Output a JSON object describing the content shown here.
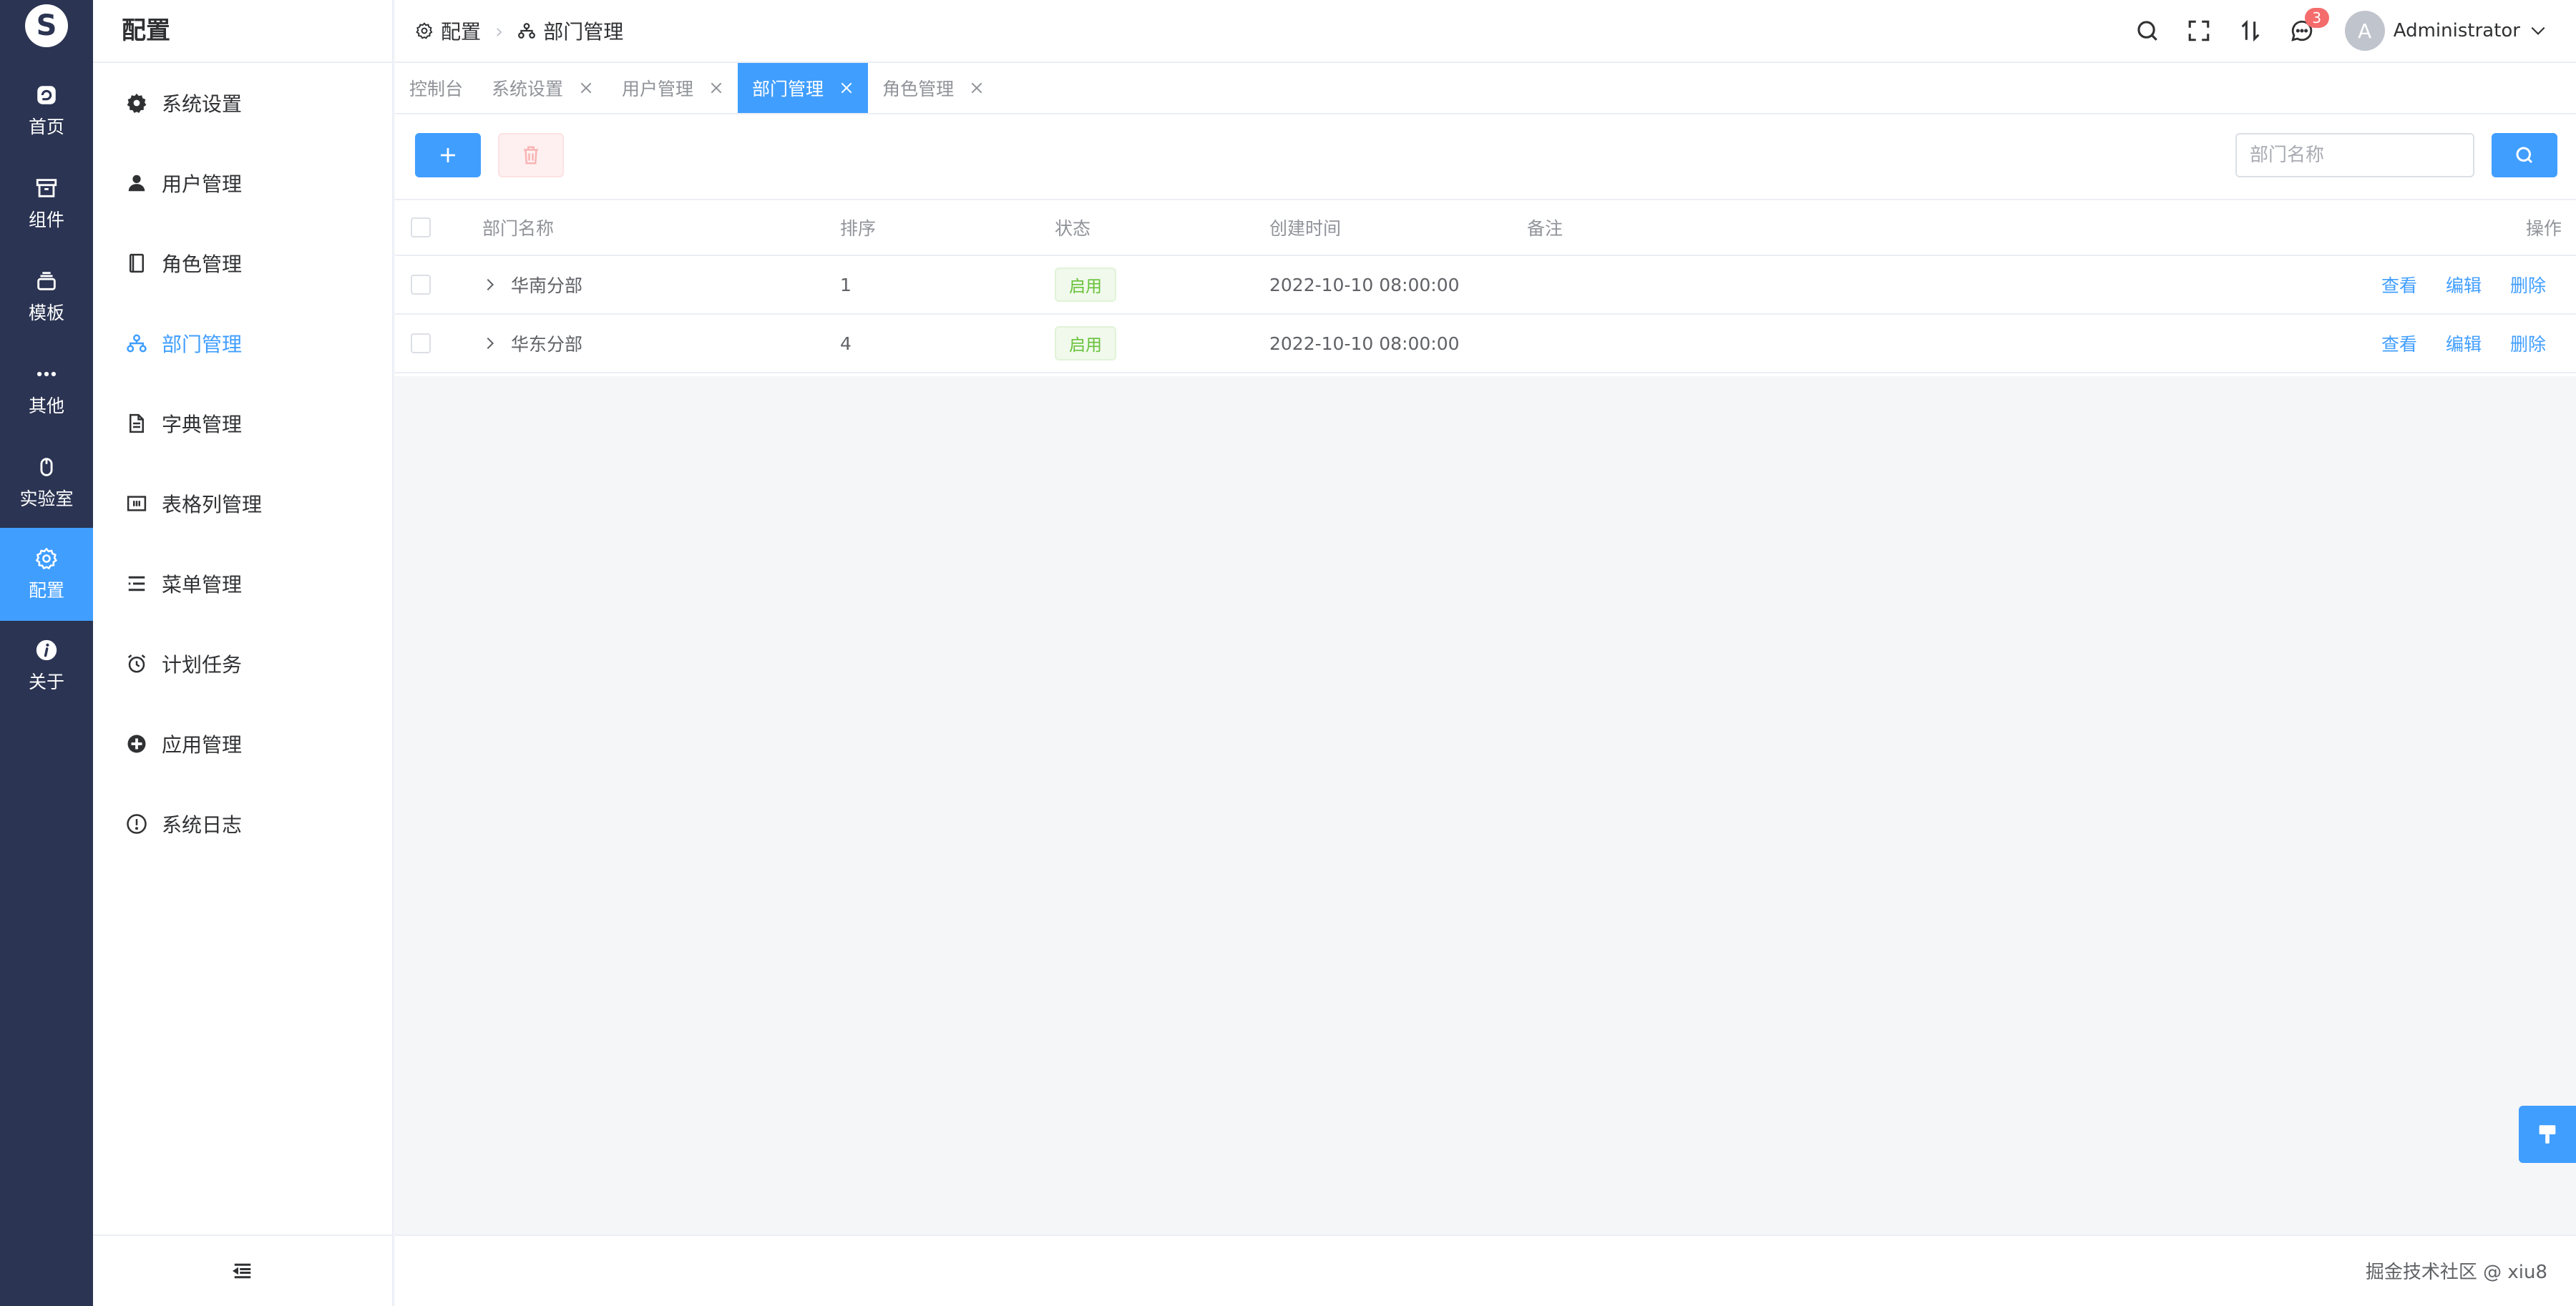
{
  "rail": {
    "logo": "S",
    "items": [
      {
        "label": "首页",
        "icon": "home-icon"
      },
      {
        "label": "组件",
        "icon": "box-icon"
      },
      {
        "label": "模板",
        "icon": "layers-icon"
      },
      {
        "label": "其他",
        "icon": "more-icon"
      },
      {
        "label": "实验室",
        "icon": "mouse-icon"
      },
      {
        "label": "配置",
        "icon": "gear-icon",
        "active": true
      },
      {
        "label": "关于",
        "icon": "info-icon"
      }
    ]
  },
  "menu": {
    "title": "配置",
    "items": [
      {
        "label": "系统设置",
        "icon": "gear-icon"
      },
      {
        "label": "用户管理",
        "icon": "user-icon"
      },
      {
        "label": "角色管理",
        "icon": "notebook-icon"
      },
      {
        "label": "部门管理",
        "icon": "org-icon",
        "active": true
      },
      {
        "label": "字典管理",
        "icon": "document-icon"
      },
      {
        "label": "表格列管理",
        "icon": "columns-icon"
      },
      {
        "label": "菜单管理",
        "icon": "menu-list-icon"
      },
      {
        "label": "计划任务",
        "icon": "alarm-clock-icon"
      },
      {
        "label": "应用管理",
        "icon": "app-icon"
      },
      {
        "label": "系统日志",
        "icon": "warning-circle-icon"
      }
    ]
  },
  "header": {
    "breadcrumb": [
      "配置",
      "部门管理"
    ],
    "notification_count": "3",
    "avatar_letter": "A",
    "username": "Administrator"
  },
  "tabs": [
    {
      "label": "控制台",
      "closable": false
    },
    {
      "label": "系统设置",
      "closable": true
    },
    {
      "label": "用户管理",
      "closable": true
    },
    {
      "label": "部门管理",
      "closable": true,
      "active": true
    },
    {
      "label": "角色管理",
      "closable": true
    }
  ],
  "toolbar": {
    "search_placeholder": "部门名称"
  },
  "table": {
    "columns": {
      "name": "部门名称",
      "sort": "排序",
      "status": "状态",
      "created": "创建时间",
      "remark": "备注",
      "actions": "操作"
    },
    "rows": [
      {
        "name": "华南分部",
        "sort": "1",
        "status": "启用",
        "created": "2022-10-10 08:00:00",
        "remark": ""
      },
      {
        "name": "华东分部",
        "sort": "4",
        "status": "启用",
        "created": "2022-10-10 08:00:00",
        "remark": ""
      }
    ],
    "actions": {
      "view": "查看",
      "edit": "编辑",
      "delete": "删除"
    }
  },
  "footer": {
    "watermark": "掘金技术社区 @ xiu8"
  },
  "colors": {
    "rail_bg": "#2b3452",
    "accent": "#409eff",
    "success": "#67c23a",
    "danger": "#f56c6c"
  }
}
